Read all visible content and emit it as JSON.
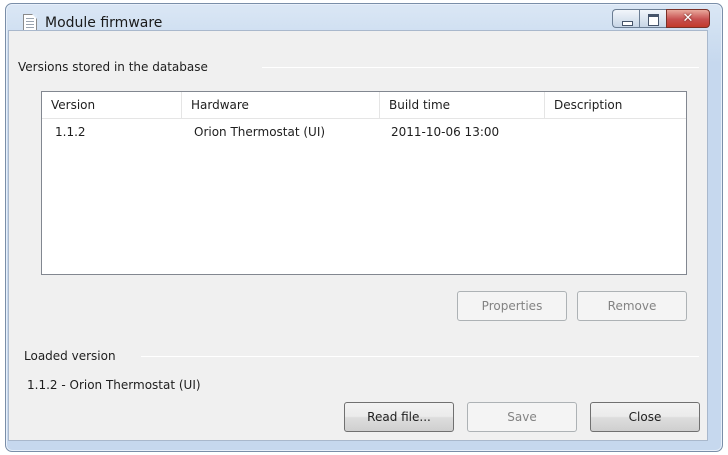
{
  "window": {
    "title": "Module firmware",
    "close_glyph": "✕"
  },
  "database_group": {
    "label": "Versions stored in the database"
  },
  "table": {
    "columns": [
      "Version",
      "Hardware",
      "Build time",
      "Description"
    ],
    "rows": [
      {
        "version": "1.1.2",
        "hardware": "Orion Thermostat (UI)",
        "build_time": "2011-10-06  13:00",
        "description": ""
      }
    ]
  },
  "buttons": {
    "properties": "Properties",
    "remove": "Remove",
    "read_file": "Read file...",
    "save": "Save",
    "close": "Close"
  },
  "loaded_group": {
    "label": "Loaded version",
    "value": "1.1.2 - Orion Thermostat (UI)"
  },
  "icons": {
    "title_icon": "document-icon",
    "minimize": "minimize-icon",
    "maximize": "maximize-icon",
    "close": "close-icon"
  }
}
